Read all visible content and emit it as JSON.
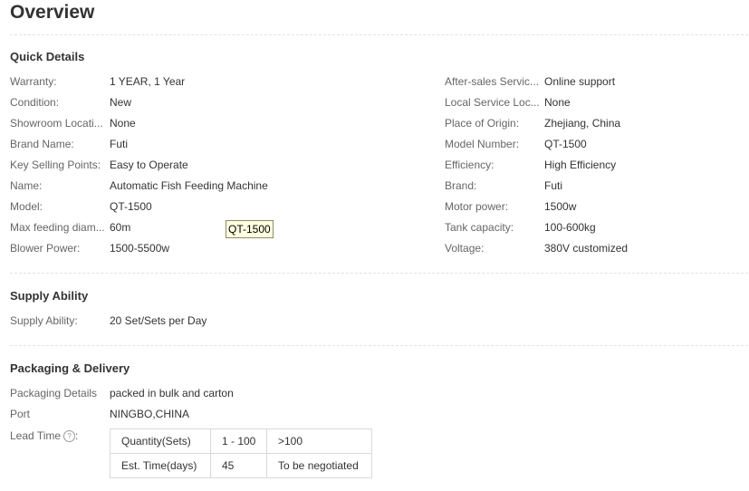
{
  "page": {
    "title": "Overview"
  },
  "quick_details": {
    "title": "Quick Details",
    "left": [
      {
        "label": "Warranty:",
        "value": "1 YEAR, 1 Year"
      },
      {
        "label": "Condition:",
        "value": "New"
      },
      {
        "label": "Showroom Locati...",
        "value": "None"
      },
      {
        "label": "Brand Name:",
        "value": "Futi"
      },
      {
        "label": "Key Selling Points:",
        "value": "Easy to Operate"
      },
      {
        "label": "Name:",
        "value": "Automatic Fish Feeding Machine"
      },
      {
        "label": "Model:",
        "value": "QT-1500"
      },
      {
        "label": "Max feeding diam...",
        "value": "60m"
      },
      {
        "label": "Blower Power:",
        "value": "1500-5500w"
      }
    ],
    "right": [
      {
        "label": "After-sales Servic...",
        "value": "Online support"
      },
      {
        "label": "Local Service Loc...",
        "value": "None"
      },
      {
        "label": "Place of Origin:",
        "value": "Zhejiang, China"
      },
      {
        "label": "Model Number:",
        "value": "QT-1500"
      },
      {
        "label": "Efficiency:",
        "value": "High Efficiency"
      },
      {
        "label": "Brand:",
        "value": "Futi"
      },
      {
        "label": "Motor power:",
        "value": "1500w"
      },
      {
        "label": "Tank capacity:",
        "value": "100-600kg"
      },
      {
        "label": "Voltage:",
        "value": "380V customized"
      }
    ]
  },
  "tooltip": {
    "text": "QT-1500"
  },
  "supply_ability": {
    "title": "Supply Ability",
    "label": "Supply Ability:",
    "value": "20 Set/Sets per Day"
  },
  "packaging": {
    "title": "Packaging & Delivery",
    "details_label": "Packaging Details",
    "details_value": "packed in bulk and carton",
    "port_label": "Port",
    "port_value": "NINGBO,CHINA",
    "lead_time_label": "Lead Time",
    "lead_time_icon": "question-icon",
    "lead_time_colon": ":",
    "table": [
      [
        "Quantity(Sets)",
        "1 - 100",
        ">100"
      ],
      [
        "Est. Time(days)",
        "45",
        "To be negotiated"
      ]
    ]
  }
}
